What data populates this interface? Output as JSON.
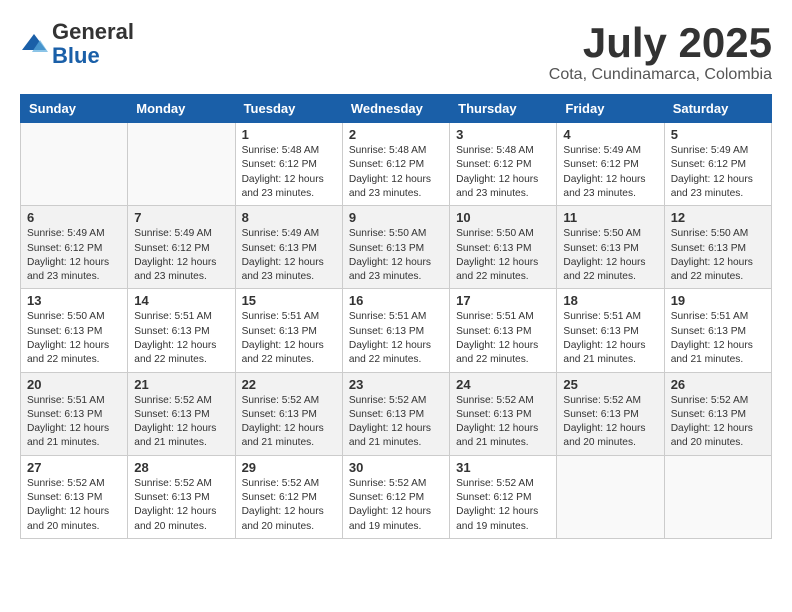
{
  "logo": {
    "general": "General",
    "blue": "Blue"
  },
  "title": "July 2025",
  "subtitle": "Cota, Cundinamarca, Colombia",
  "days_of_week": [
    "Sunday",
    "Monday",
    "Tuesday",
    "Wednesday",
    "Thursday",
    "Friday",
    "Saturday"
  ],
  "weeks": [
    [
      {
        "day": "",
        "info": ""
      },
      {
        "day": "",
        "info": ""
      },
      {
        "day": "1",
        "info": "Sunrise: 5:48 AM\nSunset: 6:12 PM\nDaylight: 12 hours and 23 minutes."
      },
      {
        "day": "2",
        "info": "Sunrise: 5:48 AM\nSunset: 6:12 PM\nDaylight: 12 hours and 23 minutes."
      },
      {
        "day": "3",
        "info": "Sunrise: 5:48 AM\nSunset: 6:12 PM\nDaylight: 12 hours and 23 minutes."
      },
      {
        "day": "4",
        "info": "Sunrise: 5:49 AM\nSunset: 6:12 PM\nDaylight: 12 hours and 23 minutes."
      },
      {
        "day": "5",
        "info": "Sunrise: 5:49 AM\nSunset: 6:12 PM\nDaylight: 12 hours and 23 minutes."
      }
    ],
    [
      {
        "day": "6",
        "info": "Sunrise: 5:49 AM\nSunset: 6:12 PM\nDaylight: 12 hours and 23 minutes."
      },
      {
        "day": "7",
        "info": "Sunrise: 5:49 AM\nSunset: 6:12 PM\nDaylight: 12 hours and 23 minutes."
      },
      {
        "day": "8",
        "info": "Sunrise: 5:49 AM\nSunset: 6:13 PM\nDaylight: 12 hours and 23 minutes."
      },
      {
        "day": "9",
        "info": "Sunrise: 5:50 AM\nSunset: 6:13 PM\nDaylight: 12 hours and 23 minutes."
      },
      {
        "day": "10",
        "info": "Sunrise: 5:50 AM\nSunset: 6:13 PM\nDaylight: 12 hours and 22 minutes."
      },
      {
        "day": "11",
        "info": "Sunrise: 5:50 AM\nSunset: 6:13 PM\nDaylight: 12 hours and 22 minutes."
      },
      {
        "day": "12",
        "info": "Sunrise: 5:50 AM\nSunset: 6:13 PM\nDaylight: 12 hours and 22 minutes."
      }
    ],
    [
      {
        "day": "13",
        "info": "Sunrise: 5:50 AM\nSunset: 6:13 PM\nDaylight: 12 hours and 22 minutes."
      },
      {
        "day": "14",
        "info": "Sunrise: 5:51 AM\nSunset: 6:13 PM\nDaylight: 12 hours and 22 minutes."
      },
      {
        "day": "15",
        "info": "Sunrise: 5:51 AM\nSunset: 6:13 PM\nDaylight: 12 hours and 22 minutes."
      },
      {
        "day": "16",
        "info": "Sunrise: 5:51 AM\nSunset: 6:13 PM\nDaylight: 12 hours and 22 minutes."
      },
      {
        "day": "17",
        "info": "Sunrise: 5:51 AM\nSunset: 6:13 PM\nDaylight: 12 hours and 22 minutes."
      },
      {
        "day": "18",
        "info": "Sunrise: 5:51 AM\nSunset: 6:13 PM\nDaylight: 12 hours and 21 minutes."
      },
      {
        "day": "19",
        "info": "Sunrise: 5:51 AM\nSunset: 6:13 PM\nDaylight: 12 hours and 21 minutes."
      }
    ],
    [
      {
        "day": "20",
        "info": "Sunrise: 5:51 AM\nSunset: 6:13 PM\nDaylight: 12 hours and 21 minutes."
      },
      {
        "day": "21",
        "info": "Sunrise: 5:52 AM\nSunset: 6:13 PM\nDaylight: 12 hours and 21 minutes."
      },
      {
        "day": "22",
        "info": "Sunrise: 5:52 AM\nSunset: 6:13 PM\nDaylight: 12 hours and 21 minutes."
      },
      {
        "day": "23",
        "info": "Sunrise: 5:52 AM\nSunset: 6:13 PM\nDaylight: 12 hours and 21 minutes."
      },
      {
        "day": "24",
        "info": "Sunrise: 5:52 AM\nSunset: 6:13 PM\nDaylight: 12 hours and 21 minutes."
      },
      {
        "day": "25",
        "info": "Sunrise: 5:52 AM\nSunset: 6:13 PM\nDaylight: 12 hours and 20 minutes."
      },
      {
        "day": "26",
        "info": "Sunrise: 5:52 AM\nSunset: 6:13 PM\nDaylight: 12 hours and 20 minutes."
      }
    ],
    [
      {
        "day": "27",
        "info": "Sunrise: 5:52 AM\nSunset: 6:13 PM\nDaylight: 12 hours and 20 minutes."
      },
      {
        "day": "28",
        "info": "Sunrise: 5:52 AM\nSunset: 6:13 PM\nDaylight: 12 hours and 20 minutes."
      },
      {
        "day": "29",
        "info": "Sunrise: 5:52 AM\nSunset: 6:12 PM\nDaylight: 12 hours and 20 minutes."
      },
      {
        "day": "30",
        "info": "Sunrise: 5:52 AM\nSunset: 6:12 PM\nDaylight: 12 hours and 19 minutes."
      },
      {
        "day": "31",
        "info": "Sunrise: 5:52 AM\nSunset: 6:12 PM\nDaylight: 12 hours and 19 minutes."
      },
      {
        "day": "",
        "info": ""
      },
      {
        "day": "",
        "info": ""
      }
    ]
  ]
}
